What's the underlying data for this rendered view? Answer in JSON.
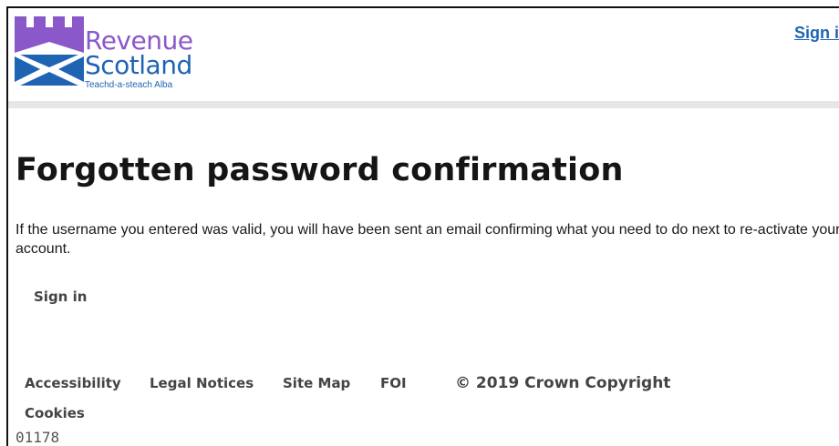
{
  "header": {
    "logo": {
      "line1": "Revenue",
      "line2": "Scotland",
      "tagline": "Teachd-a-steach Alba"
    },
    "sign_in_label": "Sign in"
  },
  "main": {
    "title": "Forgotten password confirmation",
    "message": "If the username you entered was valid, you will have been sent an email confirming what you need to do next to re-activate your account.",
    "sign_in_label": "Sign in"
  },
  "footer": {
    "links": [
      "Accessibility",
      "Legal Notices",
      "Site Map",
      "FOI",
      "Cookies"
    ],
    "copyright": "© 2019 Crown Copyright"
  },
  "build_id": "01178",
  "colors": {
    "brand_purple": "#8a58c8",
    "brand_blue": "#1f64b3",
    "link_blue": "#1f64b3"
  },
  "icons": {
    "logo_mark": "castle-saltire-icon"
  }
}
